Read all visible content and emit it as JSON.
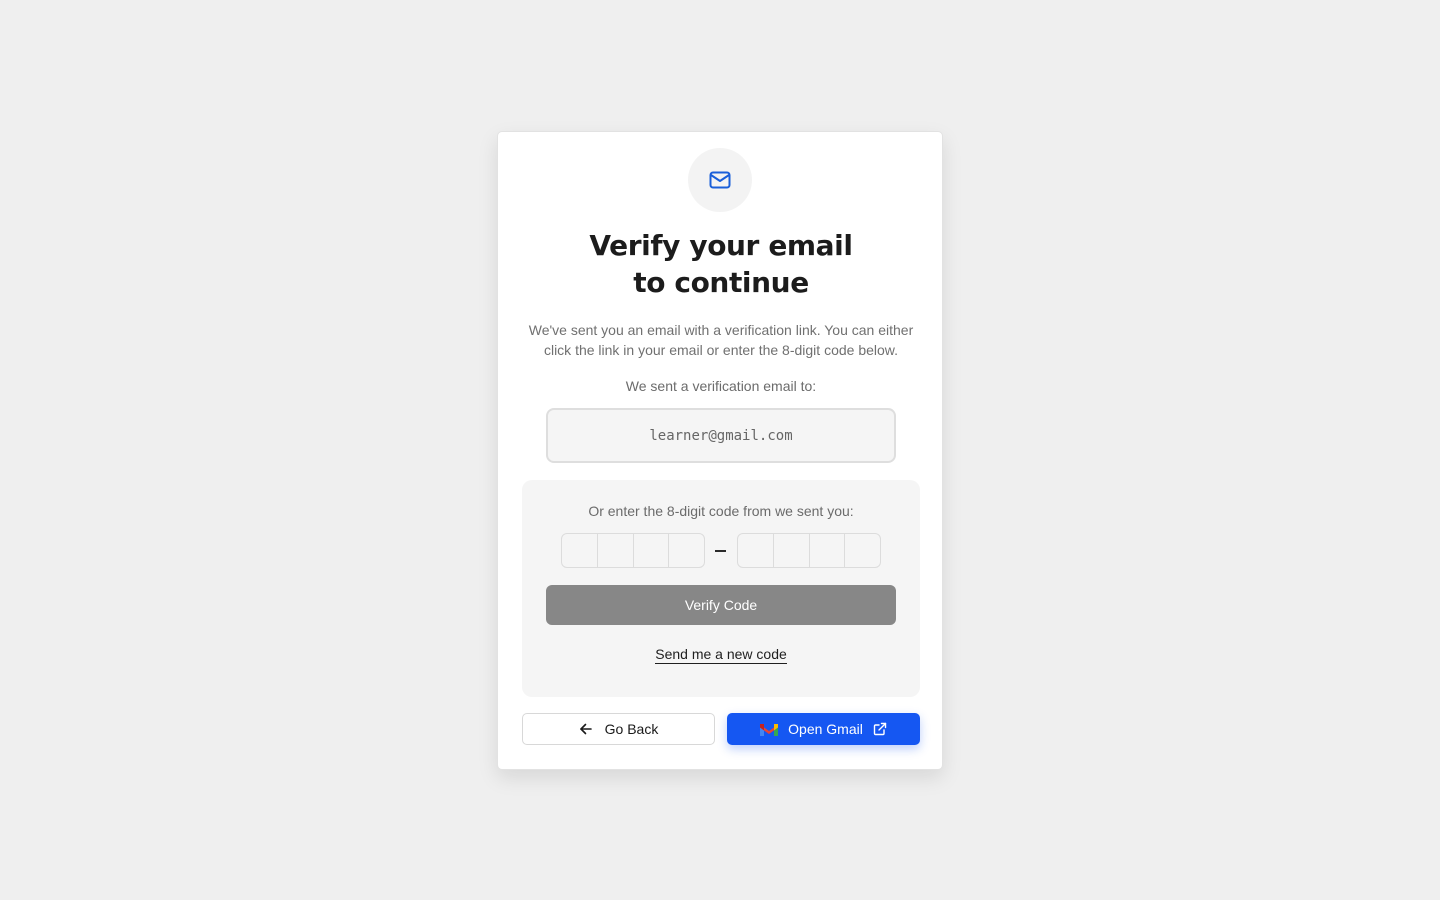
{
  "header": {
    "icon": "mail-icon",
    "title": "Verify your email\nto continue",
    "description": "We've sent you an email with a verification link. You can either click the link in your email or enter the 8-digit code below."
  },
  "email": {
    "label": "We sent a verification email to:",
    "value": "learner@gmail.com"
  },
  "code": {
    "label": "Or enter the 8-digit code from we sent you:",
    "digits": [
      "",
      "",
      "",
      "",
      "",
      "",
      "",
      ""
    ],
    "verify_label": "Verify Code",
    "resend_label": "Send me a new code"
  },
  "actions": {
    "back_label": "Go Back",
    "back_icon": "arrow-left-icon",
    "gmail_label": "Open Gmail",
    "gmail_icon": "gmail-logo-icon",
    "external_icon": "external-link-icon"
  },
  "colors": {
    "background": "#efefef",
    "card": "#ffffff",
    "accent": "#1557f2",
    "icon_blue": "#1a5fd9",
    "verify_button": "#878787",
    "panel": "#f5f5f5"
  }
}
